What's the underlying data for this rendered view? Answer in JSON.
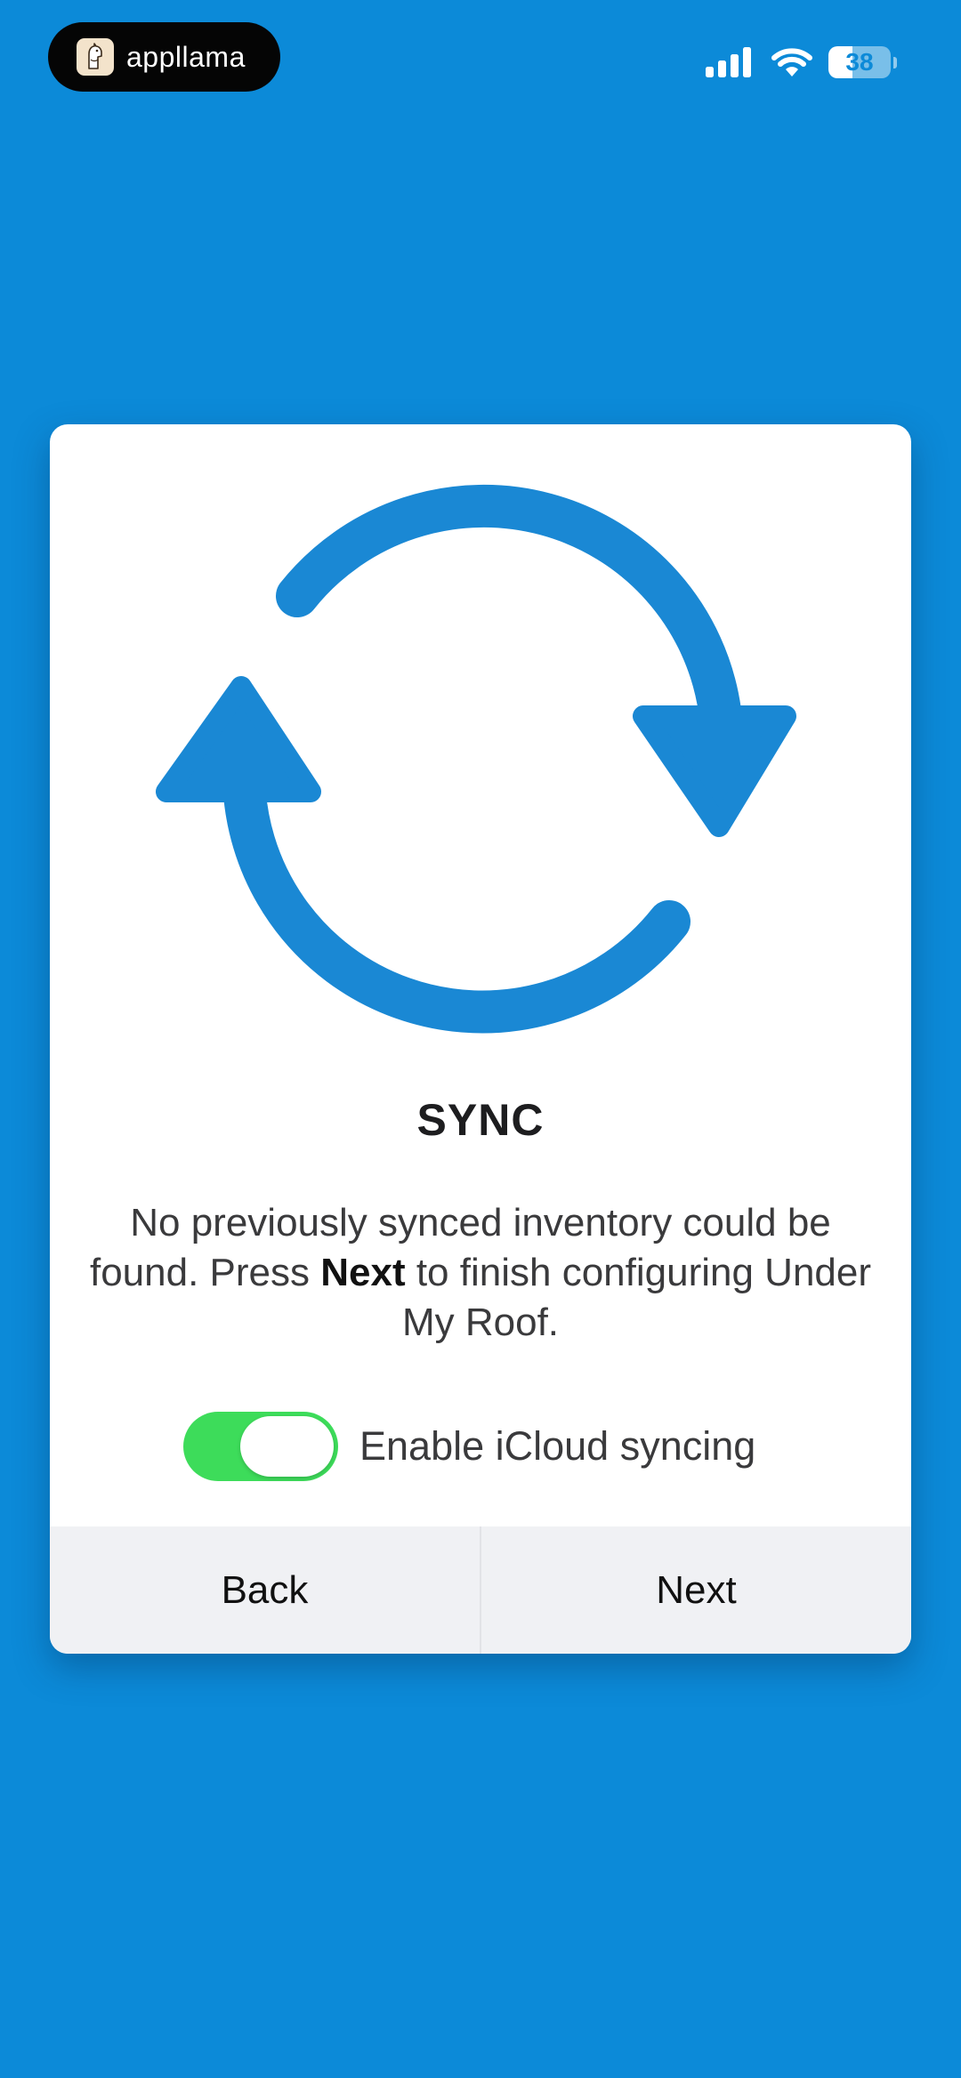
{
  "status_bar": {
    "app_badge_label": "appllama",
    "battery_level": 38,
    "battery_text": "38"
  },
  "colors": {
    "background": "#0c8ad8",
    "accent": "#1a88d4",
    "toggle_on": "#3ddc5a"
  },
  "icons": {
    "hero": "sync-arrows-icon"
  },
  "card": {
    "title": "SYNC",
    "message_part1": "No previously synced inventory could be found. Press ",
    "message_bold": "Next",
    "message_part2": " to finish configuring Under My Roof.",
    "toggle": {
      "label": "Enable iCloud syncing",
      "on": true
    },
    "buttons": {
      "back": "Back",
      "next": "Next"
    }
  }
}
